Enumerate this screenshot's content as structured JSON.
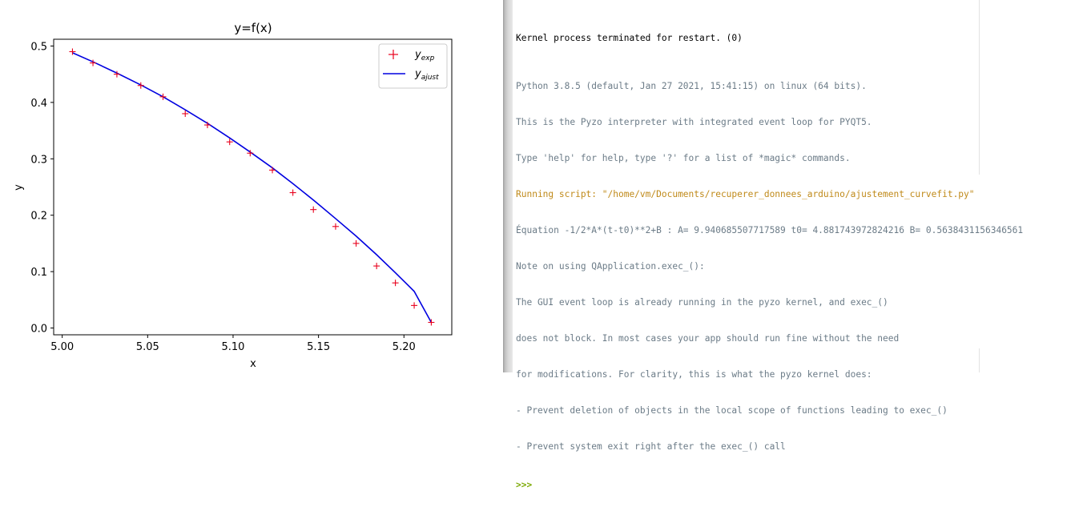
{
  "plot": {
    "title": "y=f(x)",
    "xlabel": "x",
    "ylabel": "y",
    "colors": {
      "exp": "#e8001c",
      "ajust": "#0000e0"
    }
  },
  "chart_data": {
    "type": "line",
    "title": "y=f(x)",
    "xlabel": "x",
    "ylabel": "y",
    "xlim": [
      4.995,
      5.228
    ],
    "ylim": [
      -0.012,
      0.512
    ],
    "xticks": [
      5.0,
      5.05,
      5.1,
      5.15,
      5.2
    ],
    "xtick_labels": [
      "5.00",
      "5.05",
      "5.10",
      "5.15",
      "5.20"
    ],
    "yticks": [
      0.0,
      0.1,
      0.2,
      0.3,
      0.4,
      0.5
    ],
    "ytick_labels": [
      "0.0",
      "0.1",
      "0.2",
      "0.3",
      "0.4",
      "0.5"
    ],
    "grid": false,
    "legend": "top-right",
    "series": [
      {
        "name": "y_exp",
        "legend_base": "y",
        "legend_sub": "exp",
        "marker": "+",
        "x": [
          5.006,
          5.018,
          5.032,
          5.046,
          5.059,
          5.072,
          5.085,
          5.098,
          5.11,
          5.123,
          5.135,
          5.147,
          5.16,
          5.172,
          5.184,
          5.195,
          5.206,
          5.216
        ],
        "y": [
          0.49,
          0.47,
          0.45,
          0.43,
          0.41,
          0.38,
          0.36,
          0.33,
          0.31,
          0.28,
          0.24,
          0.21,
          0.18,
          0.15,
          0.11,
          0.08,
          0.04,
          0.01
        ]
      },
      {
        "name": "y_ajust",
        "legend_base": "y",
        "legend_sub": "ajust",
        "style": "line",
        "x": [
          5.006,
          5.018,
          5.032,
          5.046,
          5.059,
          5.072,
          5.085,
          5.098,
          5.11,
          5.123,
          5.135,
          5.147,
          5.16,
          5.172,
          5.184,
          5.195,
          5.206,
          5.216
        ],
        "y": [
          0.488,
          0.472,
          0.452,
          0.431,
          0.41,
          0.387,
          0.363,
          0.337,
          0.312,
          0.284,
          0.256,
          0.227,
          0.194,
          0.163,
          0.13,
          0.098,
          0.065,
          0.01
        ]
      }
    ]
  },
  "shell": {
    "header": "Kernel process terminated for restart. (0)",
    "lines": [
      "Python 3.8.5 (default, Jan 27 2021, 15:41:15) on linux (64 bits).",
      "This is the Pyzo interpreter with integrated event loop for PYQT5.",
      "Type 'help' for help, type '?' for a list of *magic* commands."
    ],
    "running_script": "Running script: \"/home/vm/Documents/recuperer_donnees_arduino/ajustement_curvefit.py\"",
    "output": [
      "Équation -1/2*A*(t-t0)**2+B : A= 9.940685507717589 t0= 4.881743972824216 B= 0.5638431156346561",
      "Note on using QApplication.exec_():",
      "The GUI event loop is already running in the pyzo kernel, and exec_()",
      "does not block. In most cases your app should run fine without the need",
      "for modifications. For clarity, this is what the pyzo kernel does:",
      "- Prevent deletion of objects in the local scope of functions leading to exec_()",
      "- Prevent system exit right after the exec_() call"
    ],
    "prompt": ">>>",
    "colors": {
      "text": "#6b7b87",
      "header": "#000000",
      "running": "#c08a1a",
      "prompt": "#7aa800"
    }
  }
}
